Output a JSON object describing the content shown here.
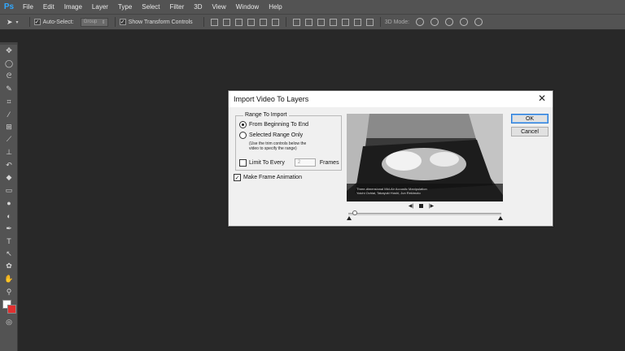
{
  "app": {
    "logo": "Ps",
    "menu": [
      "File",
      "Edit",
      "Image",
      "Layer",
      "Type",
      "Select",
      "Filter",
      "3D",
      "View",
      "Window",
      "Help"
    ]
  },
  "options_bar": {
    "auto_select_label": "Auto-Select:",
    "auto_select_value": "Group",
    "show_transform_label": "Show Transform Controls",
    "mode_label": "3D Mode:"
  },
  "tools": [
    "move-icon",
    "marquee-icon",
    "lasso-icon",
    "quick-select-icon",
    "crop-icon",
    "eyedropper-icon",
    "healing-icon",
    "brush-icon",
    "stamp-icon",
    "history-brush-icon",
    "eraser-icon",
    "gradient-icon",
    "blur-icon",
    "dodge-icon",
    "pen-icon",
    "type-icon",
    "path-select-icon",
    "shape-icon",
    "hand-icon",
    "zoom-icon"
  ],
  "colors": {
    "foreground": "#ffffff",
    "background": "#e03030",
    "accent": "#31a8ff"
  },
  "dialog": {
    "title": "Import Video To Layers",
    "range_legend": "Range To Import",
    "opt_beginning": "From Beginning To End",
    "opt_selected": "Selected Range Only",
    "hint_line1": "(Use the trim controls below the",
    "hint_line2": "video to specify the range)",
    "limit_label": "Limit To Every",
    "limit_value": "2",
    "frames_label": "Frames",
    "make_animation_label": "Make Frame Animation",
    "make_animation_checked": true,
    "preview_caption_line1": "Three-dimensional Mid-Air Acoustic Manipulation",
    "preview_caption_line2": "Yoichi Ochiai, Takayuki Hoshi, Jun Rekimoto",
    "ok_label": "OK",
    "cancel_label": "Cancel"
  }
}
